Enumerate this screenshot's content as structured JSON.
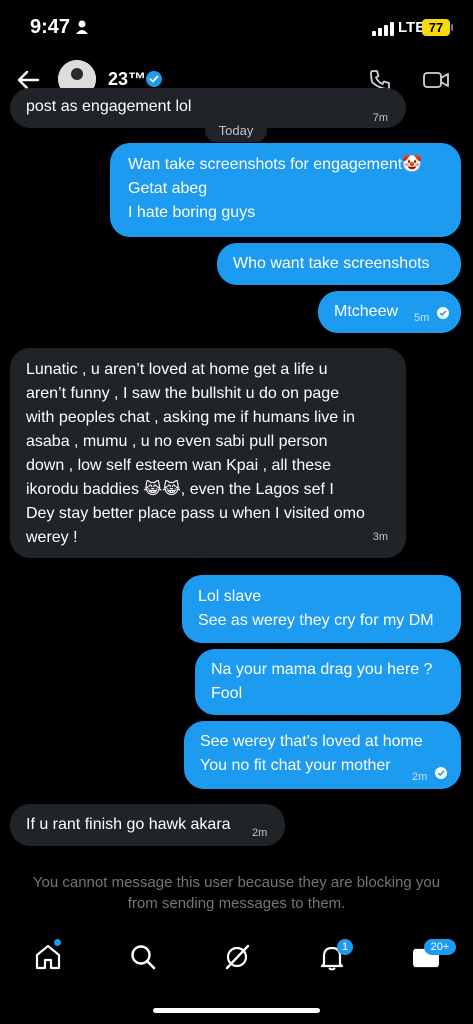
{
  "status": {
    "time": "9:47",
    "network": "LTE",
    "battery": "77"
  },
  "header": {
    "name": "23™"
  },
  "date_separator": "Today",
  "messages": [
    {
      "side": "in",
      "lines": [
        "post as engagement lol"
      ],
      "time": "7m"
    },
    {
      "side": "out",
      "lines": [
        "Wan take screenshots for engagement🤡",
        "Getat abeg",
        "I hate boring guys"
      ],
      "time": ""
    },
    {
      "side": "out",
      "lines": [
        "Who want take screenshots"
      ],
      "time": ""
    },
    {
      "side": "out",
      "lines": [
        "Mtcheew"
      ],
      "time": "5m"
    },
    {
      "side": "in",
      "lines": [
        "Lunatic , u aren’t loved at home get a life u",
        "aren’t funny , I saw the bullshit u do on page",
        "with peoples chat , asking me if humans live in",
        "asaba , mumu , u no even sabi pull person",
        "down , low self esteem wan Kpai , all these",
        "ikorodu baddies 😹😹, even the Lagos sef I",
        "Dey stay better place pass u when I visited omo",
        "werey !"
      ],
      "time": "3m"
    },
    {
      "side": "out",
      "lines": [
        "Lol slave",
        "See as werey they cry for my DM"
      ],
      "time": ""
    },
    {
      "side": "out",
      "lines": [
        "Na your mama drag you here ?",
        "Fool"
      ],
      "time": ""
    },
    {
      "side": "out",
      "lines": [
        "See werey that's loved at home",
        "You no fit chat your mother"
      ],
      "time": "2m"
    },
    {
      "side": "in",
      "lines": [
        "If u rant finish go hawk akara"
      ],
      "time": "2m"
    }
  ],
  "notice": "You cannot message this user because they are blocking you from sending messages to them.",
  "nav": {
    "notifications_badge": "1",
    "messages_badge": "20+"
  }
}
